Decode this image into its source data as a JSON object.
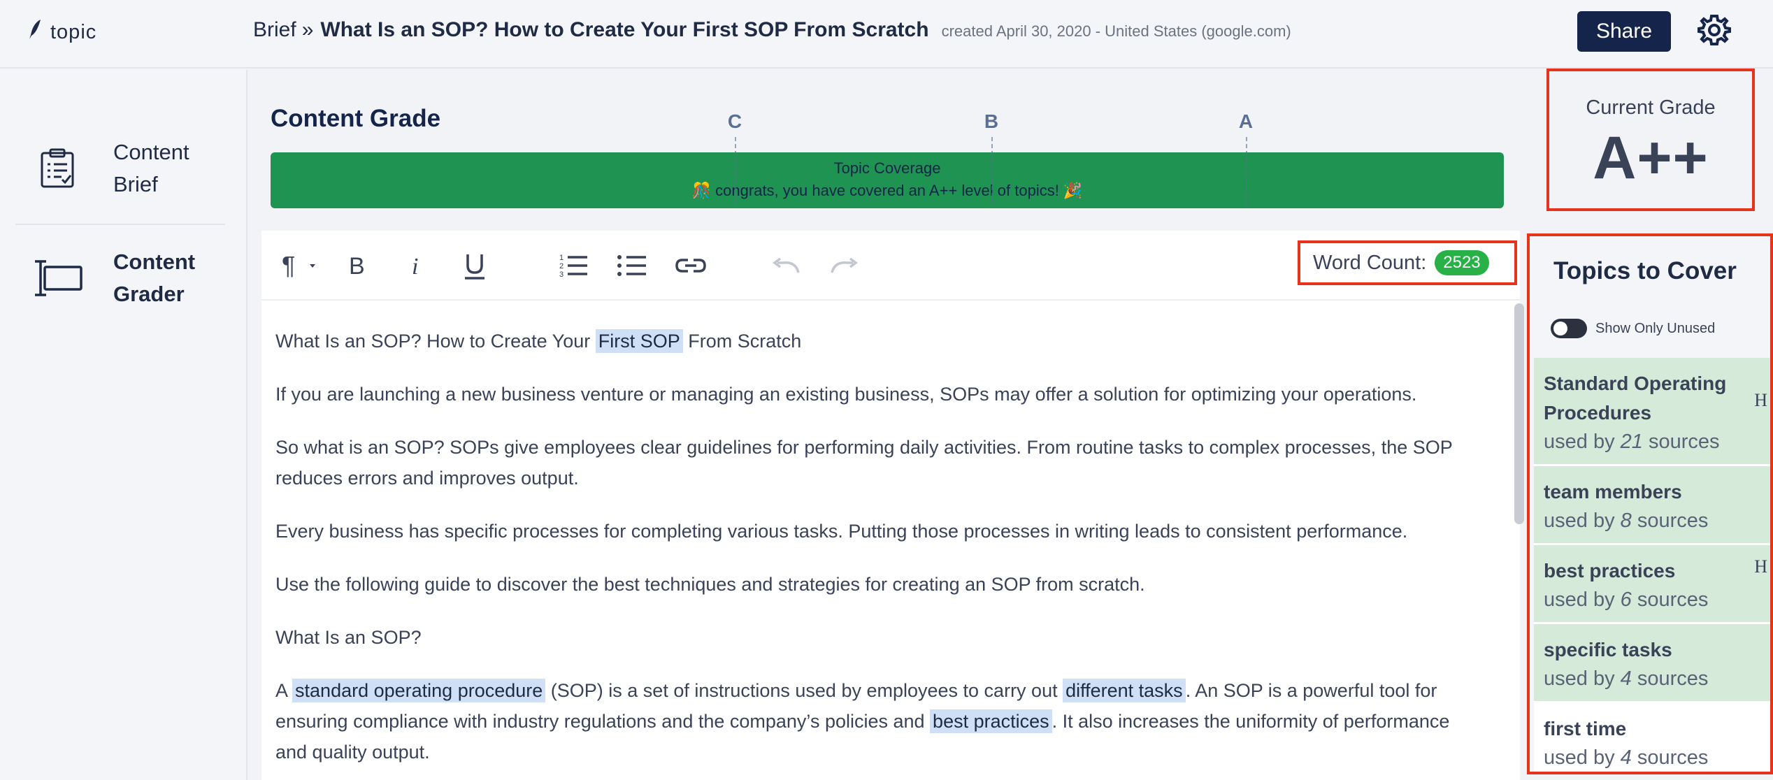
{
  "app": {
    "logo_text": "topic"
  },
  "header": {
    "breadcrumb_root": "Brief",
    "breadcrumb_separator": "»",
    "title": "What Is an SOP? How to Create Your First SOP From Scratch",
    "meta": "created April 30, 2020 - United States (google.com)",
    "share_label": "Share"
  },
  "sidebar": {
    "items": [
      {
        "label_line1": "Content",
        "label_line2": "Brief",
        "icon": "clipboard-list-icon",
        "active": false
      },
      {
        "label_line1": "Content",
        "label_line2": "Grader",
        "icon": "text-cursor-box-icon",
        "active": true
      }
    ]
  },
  "grade": {
    "title": "Content Grade",
    "marks": [
      "C",
      "B",
      "A"
    ],
    "coverage_label": "Topic Coverage",
    "coverage_message": "🎊 congrats, you have covered an A++ level of topics! 🎉",
    "coverage_color": "#1f9352",
    "current_label": "Current Grade",
    "current_value": "A++"
  },
  "toolbar": {
    "word_count_label": "Word Count:",
    "word_count_value": "2523",
    "icons": [
      "paragraph-icon",
      "bold-icon",
      "italic-icon",
      "underline-icon",
      "ordered-list-icon",
      "bullet-list-icon",
      "link-icon",
      "undo-icon",
      "redo-icon"
    ]
  },
  "content": {
    "p1_a": "What Is an SOP? How to Create Your ",
    "p1_hl": "First SOP",
    "p1_b": " From Scratch",
    "p2": "If you are launching a new business venture or managing an existing business, SOPs may offer a solution for optimizing your operations.",
    "p3": "So what is an SOP? SOPs give employees clear guidelines for performing daily activities. From routine tasks to complex processes, the SOP reduces errors and improves output.",
    "p4": "Every business has specific processes for completing various tasks. Putting those processes in writing leads to consistent performance.",
    "p5": "Use the following guide to discover the best techniques and strategies for creating an SOP from scratch.",
    "p6": "What Is an SOP?",
    "p7_a": "A ",
    "p7_hl1": "standard operating procedure",
    "p7_b": " (SOP) is a set of instructions used by employees to carry out ",
    "p7_hl2": "different tasks",
    "p7_c": ". An SOP is a powerful tool for ensuring compliance with industry regulations and the company’s policies and ",
    "p7_hl3": "best practices",
    "p7_d": ". It also increases the uniformity of performance and quality output."
  },
  "topics": {
    "title": "Topics to Cover",
    "toggle_label": "Show Only Unused",
    "used_prefix": "used by ",
    "used_suffix": " sources",
    "items": [
      {
        "name": "Standard Operating Procedures",
        "count": "21",
        "mark": "H",
        "used": true
      },
      {
        "name": "team members",
        "count": "8",
        "mark": "",
        "used": true
      },
      {
        "name": "best practices",
        "count": "6",
        "mark": "H",
        "used": true
      },
      {
        "name": "specific tasks",
        "count": "4",
        "mark": "",
        "used": true
      },
      {
        "name": "first time",
        "count": "4",
        "mark": "",
        "used": false
      }
    ]
  }
}
